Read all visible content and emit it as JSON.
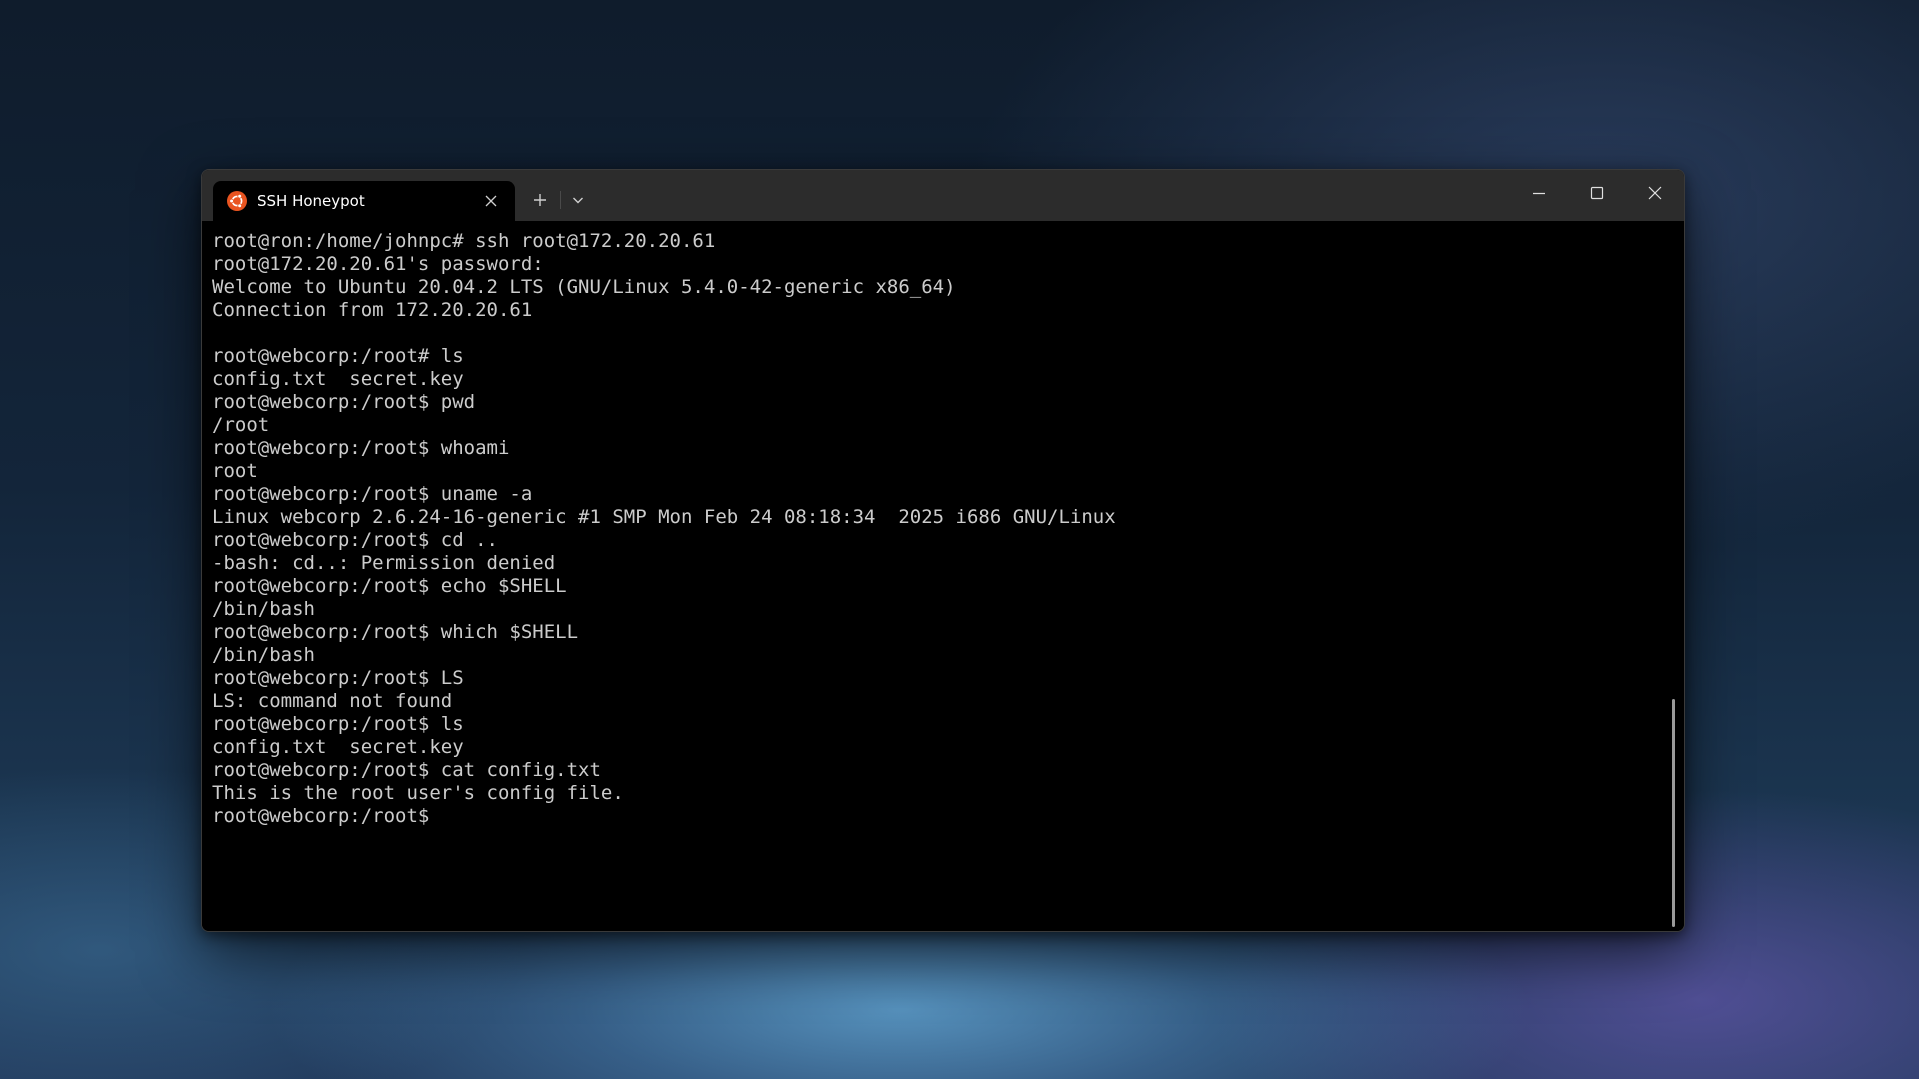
{
  "window": {
    "tab": {
      "title": "SSH Honeypot",
      "icon": "ubuntu-logo-icon"
    },
    "new_tab_icon": "plus-icon",
    "dropdown_icon": "chevron-down-icon",
    "controls": [
      "minimize-icon",
      "maximize-icon",
      "close-icon"
    ]
  },
  "terminal": {
    "lines": [
      "root@ron:/home/johnpc# ssh root@172.20.20.61",
      "root@172.20.20.61's password:",
      "Welcome to Ubuntu 20.04.2 LTS (GNU/Linux 5.4.0-42-generic x86_64)",
      "Connection from 172.20.20.61",
      "",
      "root@webcorp:/root# ls",
      "config.txt  secret.key",
      "root@webcorp:/root$ pwd",
      "/root",
      "root@webcorp:/root$ whoami",
      "root",
      "root@webcorp:/root$ uname -a",
      "Linux webcorp 2.6.24-16-generic #1 SMP Mon Feb 24 08:18:34  2025 i686 GNU/Linux",
      "root@webcorp:/root$ cd ..",
      "-bash: cd..: Permission denied",
      "root@webcorp:/root$ echo $SHELL",
      "/bin/bash",
      "root@webcorp:/root$ which $SHELL",
      "/bin/bash",
      "root@webcorp:/root$ LS",
      "LS: command not found",
      "root@webcorp:/root$ ls",
      "config.txt  secret.key",
      "root@webcorp:/root$ cat config.txt",
      "This is the root user's config file.",
      "root@webcorp:/root$"
    ]
  },
  "colors": {
    "titlebar": "#2c2c2c",
    "terminal_bg": "#000000",
    "terminal_fg": "#cccccc",
    "ubuntu_orange": "#e95420"
  }
}
